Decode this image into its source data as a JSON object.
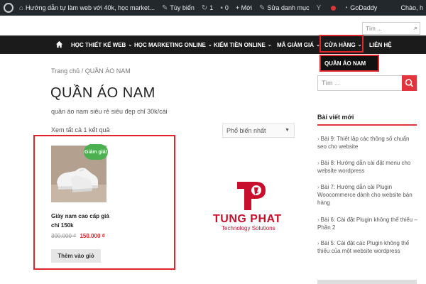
{
  "adminbar": {
    "site_title": "Hướng dẫn tự làm web với 40k, học market...",
    "customize": "Tùy biến",
    "updates": "1",
    "comments": "0",
    "new": "+ Mới",
    "edit_category": "Sửa danh mục",
    "godaddy": "GoDaddy",
    "greeting": "Chào, h"
  },
  "top_search": {
    "placeholder": "Tìm ..."
  },
  "nav": {
    "items": [
      {
        "label": "HỌC THIẾT KẾ WEB"
      },
      {
        "label": "HỌC MARKETING ONLINE"
      },
      {
        "label": "KIẾM TIỀN ONLINE"
      },
      {
        "label": "MÃ GIẢM GIÁ"
      },
      {
        "label": "CỬA HÀNG"
      },
      {
        "label": "LIÊN HỆ"
      }
    ],
    "dropdown_item": "QUẦN ÁO NAM"
  },
  "breadcrumb": "Trang chủ / QUẦN ÁO NAM",
  "page_title": "QUẦN ÁO NAM",
  "description": "quần áo nam siêu rẻ siêu đẹp chỉ 30k/cái",
  "result_count": "Xem tất cả 1 kết quả",
  "sort": {
    "selected": "Phổ biến nhất"
  },
  "product": {
    "badge": "Giảm giá!",
    "name": "Giày nam cao cấp giá chỉ 150k",
    "old_price": "300.000 ₫",
    "new_price": "150.000 ₫",
    "add_to_cart": "Thêm vào giỏ"
  },
  "watermark": {
    "name": "TUNG PHAT",
    "tagline": "Technology Solutions"
  },
  "sidebar": {
    "search_placeholder": "Tìm ...",
    "recent_title": "Bài viết mới",
    "posts": [
      "Bài 9: Thiết lập các thông số chuẩn seo cho website",
      "Bài 8: Hướng dẫn cài đặt menu cho website wordpress",
      "Bài 7: Hướng dẫn cài Plugin Woocommerce dành cho website bán hàng",
      "Bài 6: Cài đặt Plugin không thể thiếu – Phần 2",
      "Bài 5: Cài đặt các Plugin không thể thiếu của một website wordpress"
    ]
  },
  "colors": {
    "accent": "#e0262c",
    "nav_bg": "#1b1b1b",
    "adminbar_bg": "#23282d",
    "sale": "#4caf50"
  }
}
